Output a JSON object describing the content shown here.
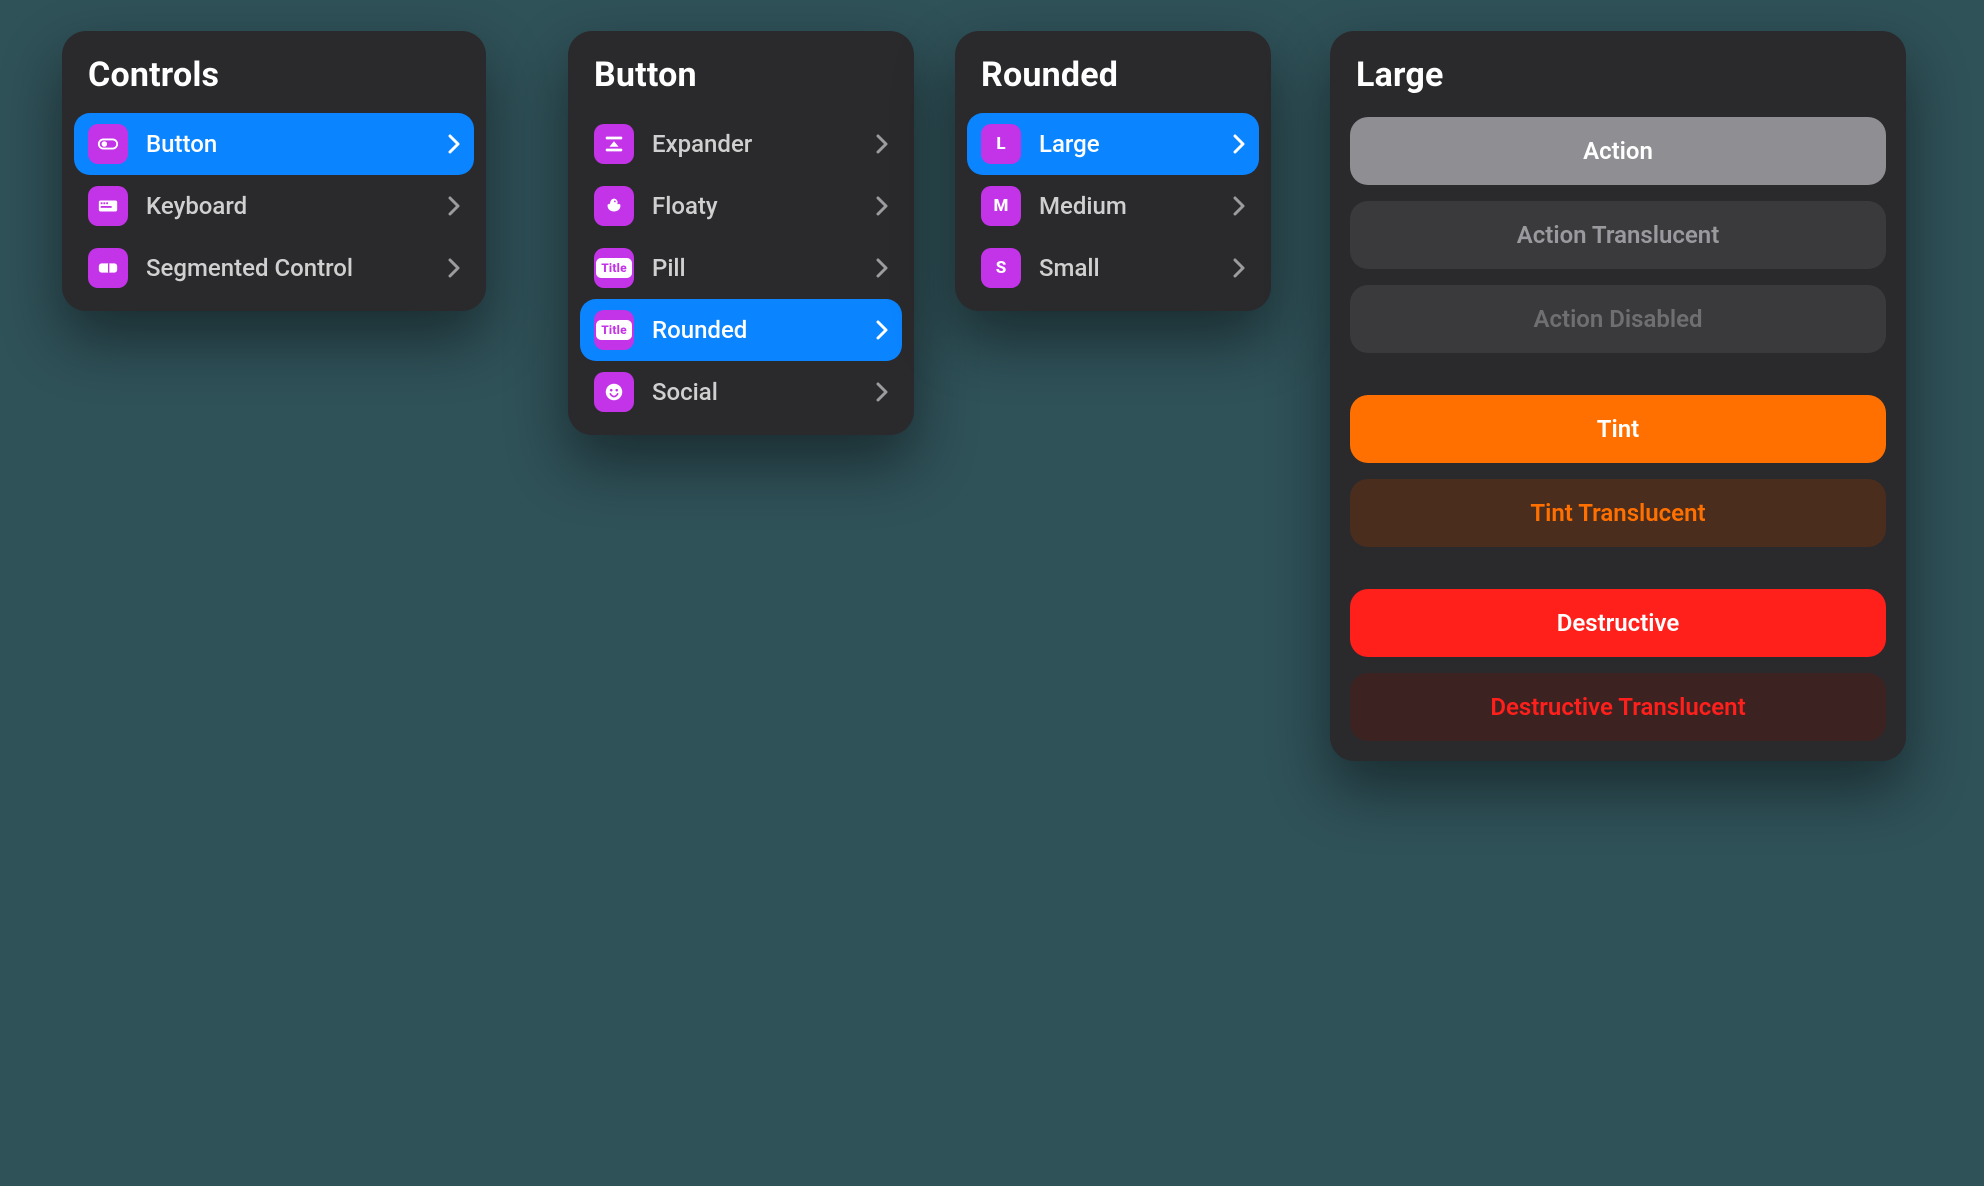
{
  "controls": {
    "title": "Controls",
    "items": [
      {
        "label": "Button",
        "icon": "toggle-icon",
        "selected": true
      },
      {
        "label": "Keyboard",
        "icon": "keyboard-icon",
        "selected": false
      },
      {
        "label": "Segmented Control",
        "icon": "segmented-icon",
        "selected": false
      }
    ]
  },
  "button": {
    "title": "Button",
    "items": [
      {
        "label": "Expander",
        "icon": "expander-icon",
        "selected": false
      },
      {
        "label": "Floaty",
        "icon": "duck-icon",
        "selected": false
      },
      {
        "label": "Pill",
        "icon": "title-tag-icon",
        "selected": false
      },
      {
        "label": "Rounded",
        "icon": "title-tag-icon",
        "selected": true
      },
      {
        "label": "Social",
        "icon": "smile-icon",
        "selected": false
      }
    ]
  },
  "rounded": {
    "title": "Rounded",
    "items": [
      {
        "label": "Large",
        "icon": "letter-l-icon",
        "selected": true
      },
      {
        "label": "Medium",
        "icon": "letter-m-icon",
        "selected": false
      },
      {
        "label": "Small",
        "icon": "letter-s-icon",
        "selected": false
      }
    ]
  },
  "large": {
    "title": "Large",
    "groups": [
      [
        {
          "label": "Action",
          "style": "action",
          "interactable": true
        },
        {
          "label": "Action Translucent",
          "style": "action-trans",
          "interactable": true
        },
        {
          "label": "Action Disabled",
          "style": "action-disabled",
          "interactable": false
        }
      ],
      [
        {
          "label": "Tint",
          "style": "tint",
          "interactable": true
        },
        {
          "label": "Tint Translucent",
          "style": "tint-trans",
          "interactable": true
        }
      ],
      [
        {
          "label": "Destructive",
          "style": "destructive",
          "interactable": true
        },
        {
          "label": "Destructive Translucent",
          "style": "destructive-trans",
          "interactable": true
        }
      ]
    ]
  },
  "icon_paths": {
    "toggle-icon": "<svg viewBox='0 0 24 24'><rect x='2' y='7' width='20' height='10' rx='5' fill='none' stroke='#fff' stroke-width='2'/><circle cx='8' cy='12' r='3' fill='#fff'/></svg>",
    "keyboard-icon": "<svg viewBox='0 0 24 24'><rect x='2' y='6' width='20' height='12' rx='2' fill='#fff'/><rect x='4' y='8' width='2' height='2' fill='%23c333e8'/><rect x='7' y='8' width='2' height='2' fill='%23c333e8'/><rect x='10' y='8' width='2' height='2' fill='%23c333e8'/><rect x='4' y='12' width='12' height='2' fill='%23c333e8'/></svg>",
    "segmented-icon": "<svg viewBox='0 0 24 24'><rect x='2' y='7' width='20' height='10' rx='3' fill='#fff'/><rect x='12' y='7' width='1.5' height='10' fill='%23c333e8'/></svg>",
    "expander-icon": "<svg viewBox='0 0 24 24'><rect x='3' y='4' width='18' height='3' rx='1' fill='#fff'/><path d='M12 9 L7 15 L17 15 Z' fill='#fff'/><rect x='3' y='17' width='18' height='3' rx='1' fill='#fff'/></svg>",
    "duck-icon": "<svg viewBox='0 0 24 24'><path d='M8 8c0-2 2-4 4-4s4 2 4 4c0 1-.5 2-1 2h3c1 0 1 1 1 2 0 4-4 6-7 6s-7-2-7-6c0-1 0-2 1-2h2c-.5 0-1-1 0-2z' fill='#fff'/><circle cx='13' cy='7' r='1' fill='%23c333e8'/></svg>",
    "title-tag-icon": "TAG:Title",
    "smile-icon": "<svg viewBox='0 0 24 24'><circle cx='12' cy='12' r='9' fill='#fff'/><circle cx='9' cy='10' r='1.4' fill='%23c333e8'/><circle cx='15' cy='10' r='1.4' fill='%23c333e8'/><path d='M8 14c1 2 3 3 4 3s3-1 4-3' stroke='%23c333e8' stroke-width='1.8' fill='none' stroke-linecap='round'/></svg>",
    "letter-l-icon": "LETTER:L",
    "letter-m-icon": "LETTER:M",
    "letter-s-icon": "LETTER:S"
  }
}
